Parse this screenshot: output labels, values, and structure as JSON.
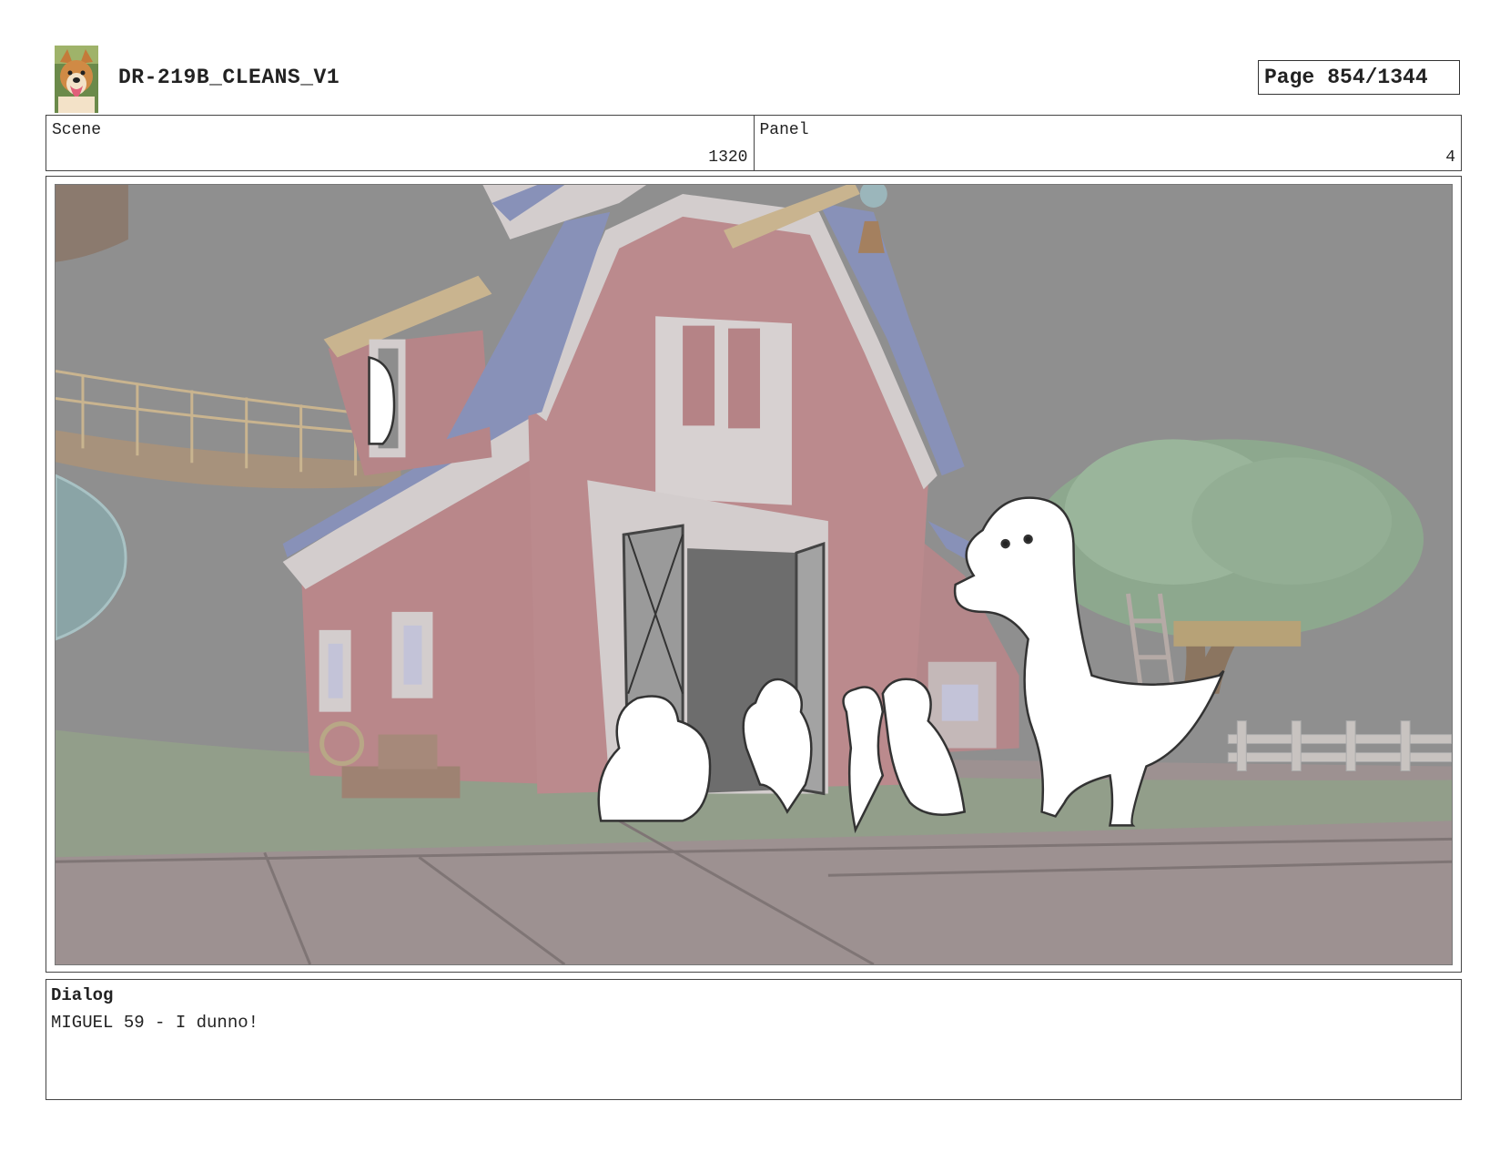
{
  "header": {
    "title": "DR-219B_CLEANS_V1",
    "page_label": "Page",
    "page_number": "854/1344"
  },
  "info": {
    "scene_label": "Scene",
    "scene_value": "1320",
    "panel_label": "Panel",
    "panel_value": "4"
  },
  "dialog": {
    "label": "Dialog",
    "text": "MIGUEL 59 - I dunno!"
  },
  "colors": {
    "sky": "#8f8f8f",
    "barn_red": "#b9878a",
    "barn_trim": "#cfcaca",
    "roof": "#8891b8",
    "grass": "#929e8a",
    "ground": "#9d9191",
    "tree": "#8da88e"
  }
}
